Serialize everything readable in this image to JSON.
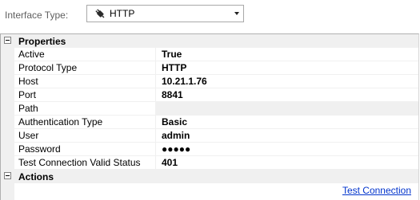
{
  "header": {
    "interface_label": "Interface Type:",
    "interface_value": "HTTP",
    "interface_icon": "plug-icon"
  },
  "properties": {
    "title": "Properties",
    "rows": [
      {
        "name": "Active",
        "value": "True"
      },
      {
        "name": "Protocol Type",
        "value": "HTTP"
      },
      {
        "name": "Host",
        "value": "10.21.1.76"
      },
      {
        "name": "Port",
        "value": "8841"
      },
      {
        "name": "Path",
        "value": ""
      },
      {
        "name": "Authentication Type",
        "value": "Basic"
      },
      {
        "name": "User",
        "value": "admin"
      },
      {
        "name": "Password",
        "value": "●●●●●"
      },
      {
        "name": "Test Connection Valid Status",
        "value": "401"
      }
    ]
  },
  "actions": {
    "title": "Actions",
    "link_label": "Test Connection"
  }
}
